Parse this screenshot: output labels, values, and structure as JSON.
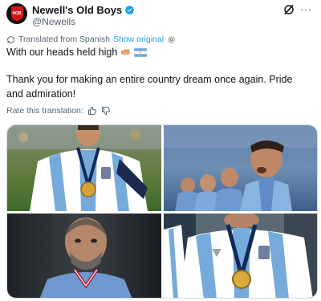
{
  "author": {
    "name": "Newell's Old Boys",
    "handle": "@Newells",
    "avatar_text": "NOB",
    "verified": true
  },
  "icons": {
    "verified": "verified-badge-icon",
    "grok": "grok-icon",
    "more": "more-icon",
    "translate": "translate-icon",
    "settings": "gear-icon",
    "thumbs_up": "thumbs-up-icon",
    "thumbs_down": "thumbs-down-icon"
  },
  "translation": {
    "note": "Translated from Spanish",
    "show_original": "Show original",
    "rate_prompt": "Rate this translation:"
  },
  "tweet": {
    "line1": "With our heads held high",
    "line2": "Thank you for making an entire country dream once again. Pride and admiration!"
  },
  "more_label": "···",
  "colors": {
    "link": "#1d9bf0",
    "secondary_text": "#536471",
    "primary_text": "#0f1419",
    "brand_red": "#d2141e",
    "border": "#cfd9de"
  },
  "media": {
    "count": 4
  }
}
